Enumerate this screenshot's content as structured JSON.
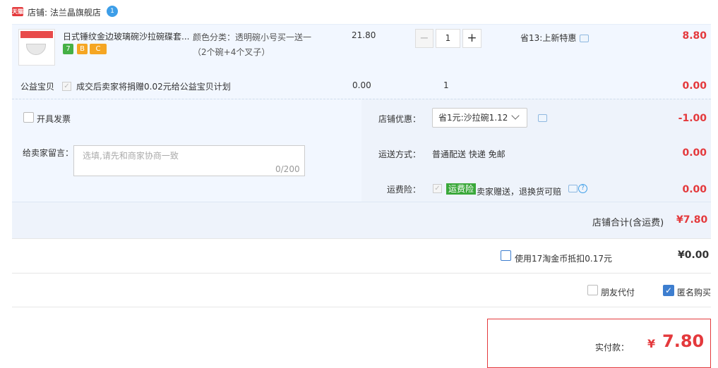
{
  "shop": {
    "prefix": "天猫",
    "label": "店铺: 法兰晶旗舰店",
    "badge": "1"
  },
  "item": {
    "title": "日式锤纹金边玻璃碗沙拉碗碟套...",
    "tags": [
      "7",
      "B",
      "C"
    ],
    "spec": "颜色分类：透明碗小号买一送一（2个碗+4个叉子）",
    "price": "21.80",
    "qty_minus": "−",
    "qty": "1",
    "qty_plus": "+",
    "promo": "省13:上新特惠",
    "total": "8.80"
  },
  "charity": {
    "label": "公益宝贝",
    "check": "✓",
    "text": "成交后卖家将捐赠0.02元给公益宝贝计划",
    "price": "0.00",
    "qty": "1",
    "total": "0.00"
  },
  "invoice": {
    "label": "开具发票"
  },
  "message": {
    "label": "给卖家留言：",
    "placeholder": "选填,请先和商家协商一致",
    "count": "0/200"
  },
  "store_discount": {
    "label": "店铺优惠：",
    "value": "省1元:沙拉碗1.12",
    "amount": "-1.00"
  },
  "shipping": {
    "label": "运送方式：",
    "value": "普通配送 快递 免邮",
    "amount": "0.00"
  },
  "insurance": {
    "label": "运费险：",
    "check": "✓",
    "badge": "运费险",
    "text": "卖家赠送，退换货可赔",
    "help": "?",
    "amount": "0.00"
  },
  "store_total": {
    "label": "店铺合计(含运费)",
    "value": "¥7.80"
  },
  "coins": {
    "label": "使用17淘金币抵扣0.17元",
    "value": "¥0.00"
  },
  "options": {
    "friend_pay": "朋友代付",
    "anonymous": "匿名购买",
    "anonymous_check": "✓"
  },
  "payment": {
    "label": "实付款：",
    "currency": "¥",
    "value": "7.80"
  },
  "colors": {
    "accent_red": "#e4393c",
    "light_blue_bg": "#f2f7ff",
    "check_blue": "#3d7ecf",
    "green": "#3aa83a"
  }
}
